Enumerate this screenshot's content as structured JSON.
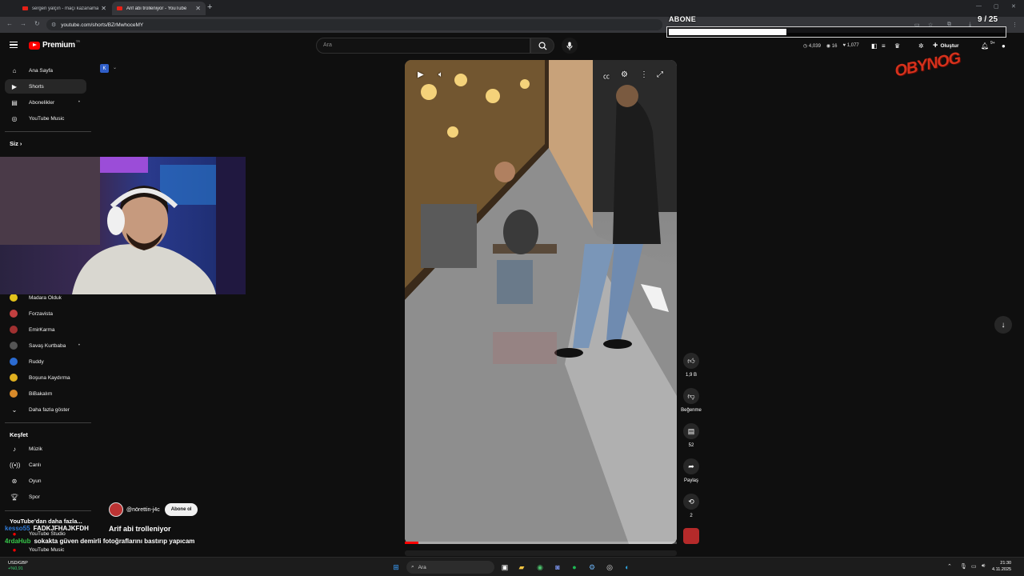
{
  "browser": {
    "tabs": [
      {
        "title": "sergen yalçın - maçı kazanamadı",
        "active": false
      },
      {
        "title": "Arif abi trolleniyor - YouTube",
        "active": true
      }
    ],
    "new_tab": "+",
    "url": "youtube.com/shorts/BZrMwhoceMY"
  },
  "overlay": {
    "label": "ABONE",
    "count": "9 / 25",
    "progress": 0.35,
    "gamer_logo": "OBYNOG"
  },
  "header": {
    "brand": "Premium",
    "tr_badge": "TR",
    "search_placeholder": "Ara",
    "stats": {
      "views": "4,039",
      "eyes": "16",
      "likes": "1,077"
    },
    "create_label": "Oluştur",
    "notif_badge": "9+"
  },
  "sidebar": {
    "main": [
      {
        "label": "Ana Sayfa",
        "icon": "home-icon"
      },
      {
        "label": "Shorts",
        "icon": "shorts-icon",
        "active": true
      },
      {
        "label": "Abonelikler",
        "icon": "subscriptions-icon"
      },
      {
        "label": "YouTube Music",
        "icon": "music-icon"
      }
    ],
    "you_heading": "Siz",
    "subscriptions": [
      {
        "label": "Madara Olduk",
        "color": "#e3c21b"
      },
      {
        "label": "Forzavista",
        "color": "#c24040"
      },
      {
        "label": "EmirKarma",
        "color": "#a03030"
      },
      {
        "label": "Savaş Kurtbaba",
        "color": "#555555"
      },
      {
        "label": "Ruddy",
        "color": "#2b6bd1"
      },
      {
        "label": "Boşuna Kaydırma",
        "color": "#e0b020"
      },
      {
        "label": "BiBakalım",
        "color": "#d88a2a"
      }
    ],
    "show_more": "Daha fazla göster",
    "explore_heading": "Keşfet",
    "explore": [
      {
        "label": "Müzik",
        "icon": "music-note-icon"
      },
      {
        "label": "Canlı",
        "icon": "live-icon"
      },
      {
        "label": "Oyun",
        "icon": "gaming-icon"
      },
      {
        "label": "Spor",
        "icon": "trophy-icon"
      }
    ],
    "more_heading": "YouTube'dan daha fazla...",
    "more_items": [
      {
        "label": "YouTube Studio"
      },
      {
        "label": "YouTube Music"
      }
    ]
  },
  "chat": [
    {
      "user": "kesso55",
      "message": "FADKJFHAJKFDH"
    },
    {
      "user": "4rdaHub",
      "message": "sokakta güven demirli fotoğraflarını bastırıp yapıcam"
    }
  ],
  "short": {
    "channel": "@nörettin-j4c",
    "subscribe_label": "Abone ol",
    "title": "Arif abi trolleniyor",
    "progress": 0.05
  },
  "actions": {
    "likes": "1,9 B",
    "dislike_label": "Beğenme",
    "comments": "52",
    "share_label": "Paylaş",
    "remix": "2"
  },
  "taskbar": {
    "ticker": "USD/GBP",
    "ticker_change": "+%0,91",
    "search_label": "Ara",
    "time": "21:30",
    "date": "4.11.2025"
  }
}
